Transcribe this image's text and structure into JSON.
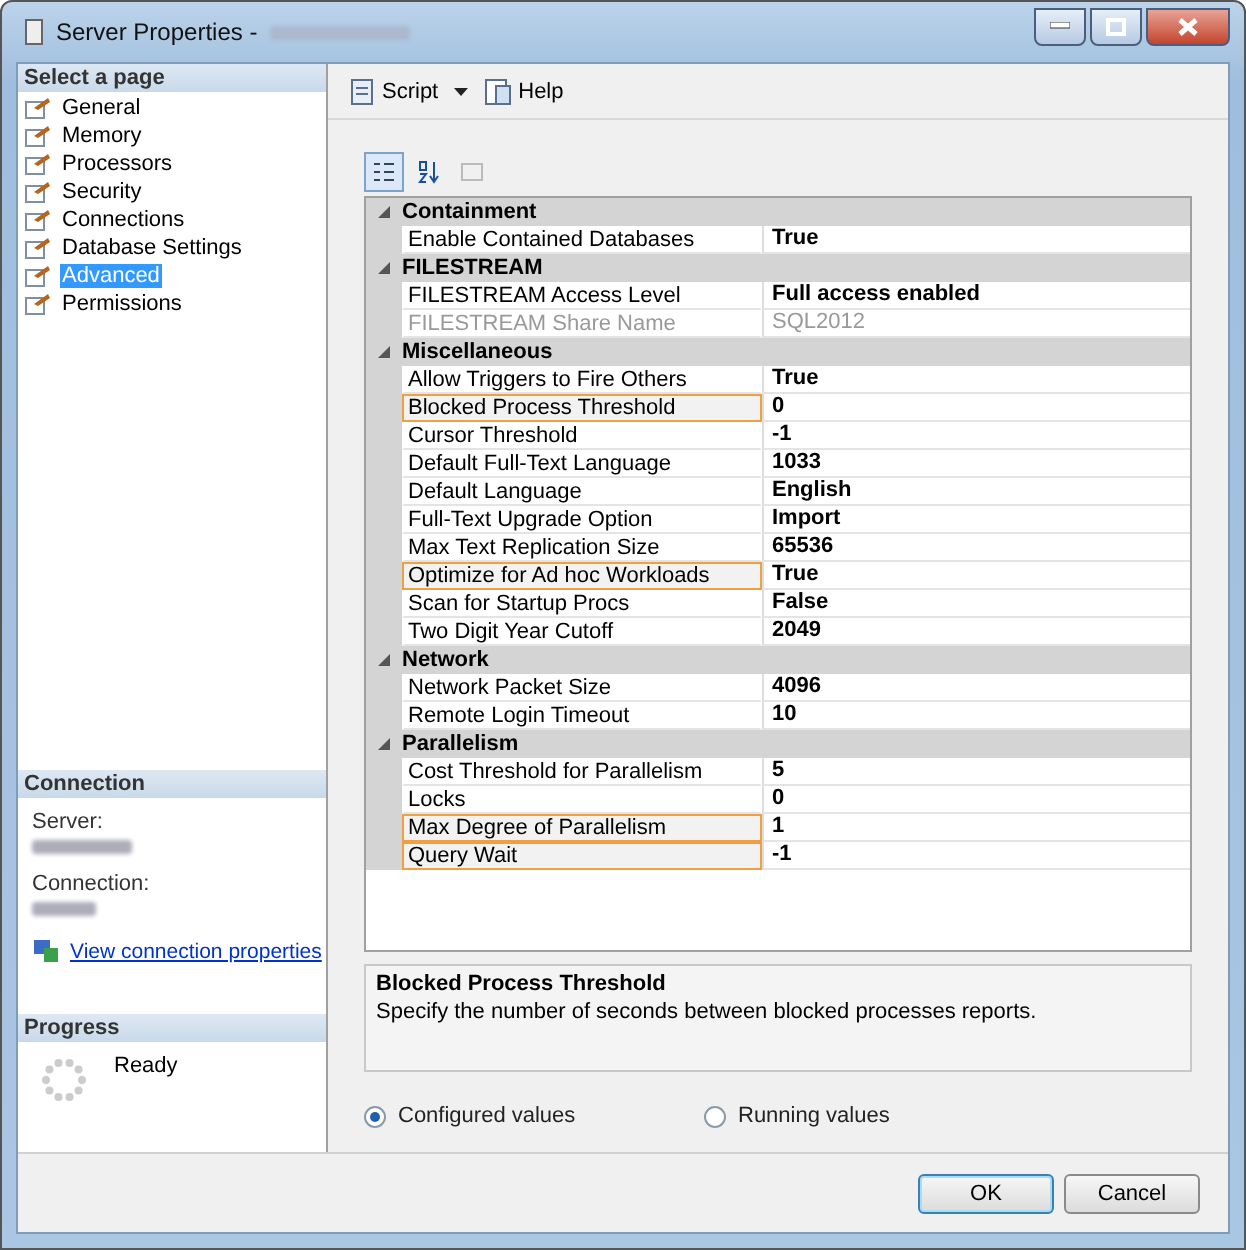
{
  "window": {
    "title": "Server Properties -"
  },
  "sidebar": {
    "header": "Select a page",
    "items": [
      {
        "label": "General",
        "selected": false
      },
      {
        "label": "Memory",
        "selected": false
      },
      {
        "label": "Processors",
        "selected": false
      },
      {
        "label": "Security",
        "selected": false
      },
      {
        "label": "Connections",
        "selected": false
      },
      {
        "label": "Database Settings",
        "selected": false
      },
      {
        "label": "Advanced",
        "selected": true
      },
      {
        "label": "Permissions",
        "selected": false
      }
    ]
  },
  "connection": {
    "header": "Connection",
    "server_label": "Server:",
    "connection_label": "Connection:",
    "link": "View connection properties"
  },
  "progress": {
    "header": "Progress",
    "status": "Ready"
  },
  "toolbar": {
    "script": "Script",
    "help": "Help"
  },
  "grid": {
    "categorized_selected": true,
    "categories": [
      {
        "name": "Containment",
        "expanded": true,
        "rows": [
          {
            "name": "Enable Contained Databases",
            "value": "True",
            "highlighted": false,
            "disabled": false
          }
        ]
      },
      {
        "name": "FILESTREAM",
        "expanded": true,
        "rows": [
          {
            "name": "FILESTREAM Access Level",
            "value": "Full access enabled",
            "highlighted": false,
            "disabled": false
          },
          {
            "name": "FILESTREAM Share Name",
            "value": "SQL2012",
            "highlighted": false,
            "disabled": true
          }
        ]
      },
      {
        "name": "Miscellaneous",
        "expanded": true,
        "rows": [
          {
            "name": "Allow Triggers to Fire Others",
            "value": "True",
            "highlighted": false,
            "disabled": false
          },
          {
            "name": "Blocked Process Threshold",
            "value": "0",
            "highlighted": true,
            "disabled": false
          },
          {
            "name": "Cursor Threshold",
            "value": "-1",
            "highlighted": false,
            "disabled": false
          },
          {
            "name": "Default Full-Text Language",
            "value": "1033",
            "highlighted": false,
            "disabled": false
          },
          {
            "name": "Default Language",
            "value": "English",
            "highlighted": false,
            "disabled": false
          },
          {
            "name": "Full-Text Upgrade Option",
            "value": "Import",
            "highlighted": false,
            "disabled": false
          },
          {
            "name": "Max Text Replication Size",
            "value": "65536",
            "highlighted": false,
            "disabled": false
          },
          {
            "name": "Optimize for Ad hoc Workloads",
            "value": "True",
            "highlighted": true,
            "disabled": false
          },
          {
            "name": "Scan for Startup Procs",
            "value": "False",
            "highlighted": false,
            "disabled": false
          },
          {
            "name": "Two Digit Year Cutoff",
            "value": "2049",
            "highlighted": false,
            "disabled": false
          }
        ]
      },
      {
        "name": "Network",
        "expanded": true,
        "rows": [
          {
            "name": "Network Packet Size",
            "value": "4096",
            "highlighted": false,
            "disabled": false
          },
          {
            "name": "Remote Login Timeout",
            "value": "10",
            "highlighted": false,
            "disabled": false
          }
        ]
      },
      {
        "name": "Parallelism",
        "expanded": true,
        "rows": [
          {
            "name": "Cost Threshold for Parallelism",
            "value": "5",
            "highlighted": false,
            "disabled": false
          },
          {
            "name": "Locks",
            "value": "0",
            "highlighted": false,
            "disabled": false
          },
          {
            "name": "Max Degree of Parallelism",
            "value": "1",
            "highlighted": true,
            "disabled": false
          },
          {
            "name": "Query Wait",
            "value": "-1",
            "highlighted": true,
            "disabled": false
          }
        ]
      }
    ]
  },
  "description": {
    "title": "Blocked Process Threshold",
    "text": "Specify the number of seconds between blocked processes reports."
  },
  "radios": [
    {
      "label": "Configured values",
      "selected": true
    },
    {
      "label": "Running values",
      "selected": false
    }
  ],
  "buttons": [
    {
      "label": "OK",
      "default": true
    },
    {
      "label": "Cancel",
      "default": false
    }
  ]
}
